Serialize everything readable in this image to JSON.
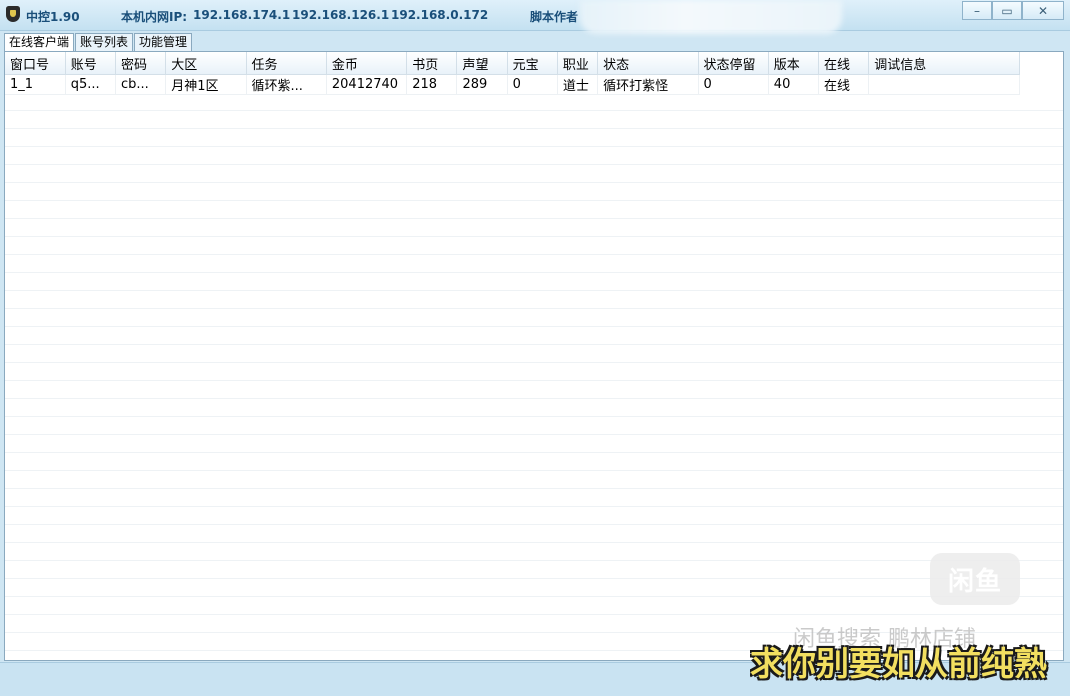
{
  "window": {
    "title": "中控1.90",
    "ip_label": "本机内网IP:",
    "ips": [
      "192.168.174.1",
      "192.168.126.1",
      "192.168.0.172"
    ],
    "author_label": "脚本作者"
  },
  "tabs": [
    {
      "label": "在线客户端",
      "active": true
    },
    {
      "label": "账号列表",
      "active": false
    },
    {
      "label": "功能管理",
      "active": false
    }
  ],
  "table": {
    "columns": [
      "窗口号",
      "账号",
      "密码",
      "大区",
      "任务",
      "金币",
      "书页",
      "声望",
      "元宝",
      "职业",
      "状态",
      "状态停留",
      "版本",
      "在线",
      "调试信息"
    ],
    "rows": [
      [
        "1_1",
        "q5...",
        "cb...",
        "月神1区",
        "循环紫...",
        "20412740",
        "218",
        "289",
        "0",
        "道士",
        "循环打紫怪",
        "0",
        "40",
        "在线",
        ""
      ]
    ]
  },
  "overlay": {
    "logo_text": "闲鱼",
    "shop_text": "闲鱼搜索 鹏林店铺",
    "subtitle": "求你别要如从前纯熟"
  },
  "colors": {
    "title_text": "#1a4f7a",
    "subtitle_fill": "#f2df60"
  }
}
